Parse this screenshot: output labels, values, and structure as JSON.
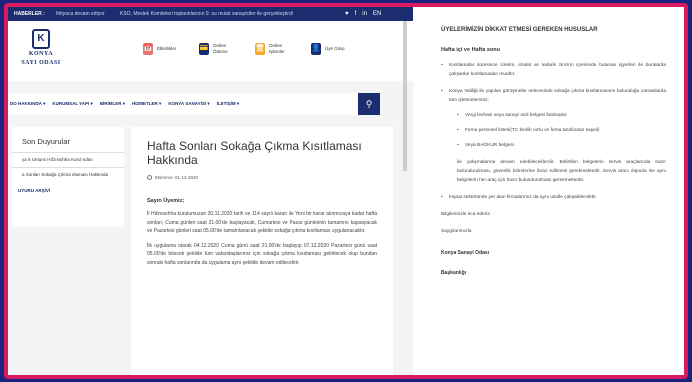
{
  "news_bar": {
    "label": "HABERLER :",
    "item1": "Ihtiyaca devam ediyor",
    "item2": "KSO, Meslek Komiteleri toplantılarının 9. su mutat sanayiciler ile gerçekleştirdi",
    "social": [
      "♥",
      "f",
      "in",
      "EN"
    ]
  },
  "logo": {
    "emblem": "K",
    "line1": "KONYA",
    "line2": "SAYI ODASI"
  },
  "top_links": [
    {
      "label": "Etkinlikler",
      "icon": "📅",
      "color": "#e57373"
    },
    {
      "label": "Online Ödeme",
      "icon": "💳",
      "color": "#1b2d6e"
    },
    {
      "label": "Online İşlemler",
      "icon": "🖥",
      "color": "#f9a825"
    },
    {
      "label": "Üye Girişi",
      "icon": "👤",
      "color": "#1b2d6e"
    }
  ],
  "nav": [
    "DO HAKKINDA ▾",
    "KURUMSAL YAPI ▾",
    "BİRİMLER ▾",
    "HİZMETLER ▾",
    "KONYA SANAYİSİ ▾",
    "İLETİŞİM ▾"
  ],
  "search_icon_glyph": "⚲",
  "sidebar": {
    "title": "Son Duyurular",
    "items": [
      "ya 8 Umumi Hıfzıssıhha Kurul ndan",
      "a Sonları Sokağa Çıkma ıtlaması Hakkında"
    ],
    "archive": "UYURU ARŞİVİ"
  },
  "article": {
    "title": "Hafta Sonları Sokağa Çıkma Kısıtlaması Hakkında",
    "date": "Eklenme: 01-12-2020",
    "salute": "Sayın Üyemiz;",
    "p1": "İl Hıfzıssıhha kurulumuzun 30.11.2020 tarih ve 114 sayılı kararı ile Yeni bir karar alınmıcaya kadar hafta sonları; Cuma günleri saat 21.00'de başlayacak, Cumartesi ve Pazar günlerinin tamamını kapsayacak ve Pazartesi günleri saat 05.00'de tamamlanacak şekilde sokağa çıkma kısıtlaması uygulanacaktır.",
    "p2": "İlk uygulama olarak 04.12.2020 Cuma günü saat 21.00'de başlayıp 07.12.2020 Pazartesi günü saat 05.00'de bitecek şekilde tüm vatandaşlarımız için sokağa çıkma kısıtlaması getirilecek olup bundan sonraki hafta sonlarında da uygulama aynı şekilde devam edilecektir."
  },
  "doc": {
    "title": "ÜYELERİMİZİN DİKKAT ETMESİ GEREKEN HUSUSLAR",
    "subtitle": "Hafta içi ve Hafta sonu",
    "b1": "Kısıtlamalar süresince Üretim, imalat ve tedarik zincirin içerisinde bulunan işyerleri ile buralarda çalışanlar kısıtlamadan muaftır.",
    "b2": "Konya Valiliği ile yapılan görüşmeler neticesinde sokağa çıkma kısıtlamasının bulunduğu zamanlarda tüm işletmelerimiz;",
    "sub_bullets": [
      "Vergi levhası veya sanayi sicil belgesi fotokopisi",
      "Firma personel listesi(TC kimlik no'lu ve firma tarafından kaşeli)",
      "Veya BAĞKUR belgesi"
    ],
    "indent": "ile çalışmalarına devam edebileceklerdir. Belirtilen belgelerin servis araçlarında hazır bulundurulması, güvenlik birimlerine ibraz edilmesi gerekmektedir. Servis aracı dışında ise aynı belgelerin her araç için hazır bulundurulması gerekmektedir.",
    "b3": "İnşaat sektöründe yer alan firmalarımız da aynı usulle çalışabilecektir.",
    "closing1": "Bilgilerinizle rica ederiz.",
    "closing2": "Saygılarımızla",
    "org": "Konya Sanayi Odası",
    "role": "Başkanlığı"
  }
}
